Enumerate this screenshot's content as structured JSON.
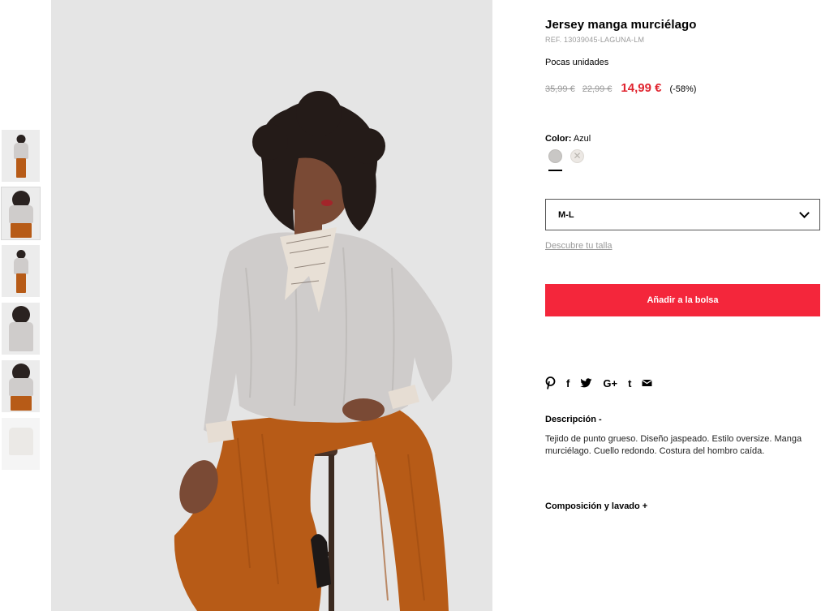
{
  "product": {
    "title": "Jersey manga murciélago",
    "ref": "REF. 13039045-LAGUNA-LM",
    "stock_note": "Pocas unidades",
    "price_original": "35,99 €",
    "price_previous": "22,99 €",
    "price_current": "14,99 €",
    "discount": "(-58%)"
  },
  "color": {
    "label": "Color:",
    "selected": "Azul",
    "swatches": [
      {
        "name": "azul",
        "hex": "#c9c7c5",
        "available": true
      },
      {
        "name": "crudo",
        "hex": "#ece8e4",
        "available": false
      }
    ]
  },
  "size": {
    "selected": "M-L",
    "guide_link": "Descubre tu talla"
  },
  "cart": {
    "add_label": "Añadir a la bolsa"
  },
  "share": {
    "icons": [
      "pinterest-icon",
      "facebook-icon",
      "twitter-icon",
      "google-plus-icon",
      "tumblr-icon",
      "email-icon"
    ],
    "pinterest": "P",
    "facebook": "f",
    "google": "G+",
    "tumblr": "t"
  },
  "description": {
    "title": "Descripción  -",
    "body": "Tejido de punto grueso. Diseño jaspeado. Estilo oversize. Manga murciélago. Cuello redondo. Costura del hombro caída."
  },
  "composition": {
    "title": "Composición y lavado  +"
  },
  "colors": {
    "accent_red": "#f4263b",
    "price_red": "#e0242f",
    "sweater_grey": "#cfcccb",
    "pants_rust": "#b75b17"
  }
}
